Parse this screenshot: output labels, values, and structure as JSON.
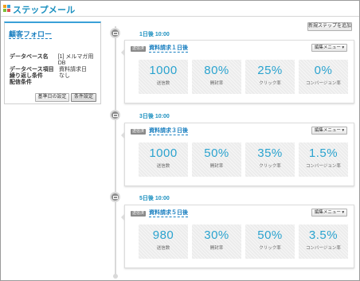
{
  "app": {
    "title": "ステップメール"
  },
  "sidebar": {
    "title": "顧客フォロー",
    "rows": [
      {
        "key": "データベース名",
        "value": "[1] メルマガ用DB"
      },
      {
        "key": "データベース項目",
        "value": "資料請求日"
      },
      {
        "key": "繰り返し条件",
        "value": "なし"
      },
      {
        "key": "配信条件",
        "value": ""
      }
    ],
    "btn_base_date": "基準日の設定",
    "btn_condition": "条件設定"
  },
  "toolbar": {
    "add_step": "新規ステップを追加"
  },
  "steps": [
    {
      "time": "1日後  10:00",
      "badge": "送信済",
      "name": "資料請求１日後",
      "menu": "編集メニュー ▾",
      "stats": [
        {
          "value": "1000",
          "label": "送信数"
        },
        {
          "value": "80%",
          "label": "開封率"
        },
        {
          "value": "25%",
          "label": "クリック率"
        },
        {
          "value": "0%",
          "label": "コンバージョン率"
        }
      ]
    },
    {
      "time": "3日後  10:00",
      "badge": "送信済",
      "name": "資料請求３日後",
      "menu": "編集メニュー ▾",
      "stats": [
        {
          "value": "1000",
          "label": "送信数"
        },
        {
          "value": "50%",
          "label": "開封率"
        },
        {
          "value": "35%",
          "label": "クリック率"
        },
        {
          "value": "1.5%",
          "label": "コンバージョン率"
        }
      ]
    },
    {
      "time": "5日後  10:00",
      "badge": "送信済",
      "name": "資料請求５日後",
      "menu": "編集メニュー ▾",
      "stats": [
        {
          "value": "980",
          "label": "送信数"
        },
        {
          "value": "30%",
          "label": "開封率"
        },
        {
          "value": "50%",
          "label": "クリック率"
        },
        {
          "value": "3.5%",
          "label": "コンバージョン率"
        }
      ]
    }
  ],
  "colors": {
    "accent": "#1a8fbf",
    "stat_value": "#2aa3cf",
    "timeline": "#d9d9d9",
    "node": "#8c8c8c"
  },
  "icons": {
    "app": "grid-icon",
    "timeline_node": "envelope-icon"
  }
}
